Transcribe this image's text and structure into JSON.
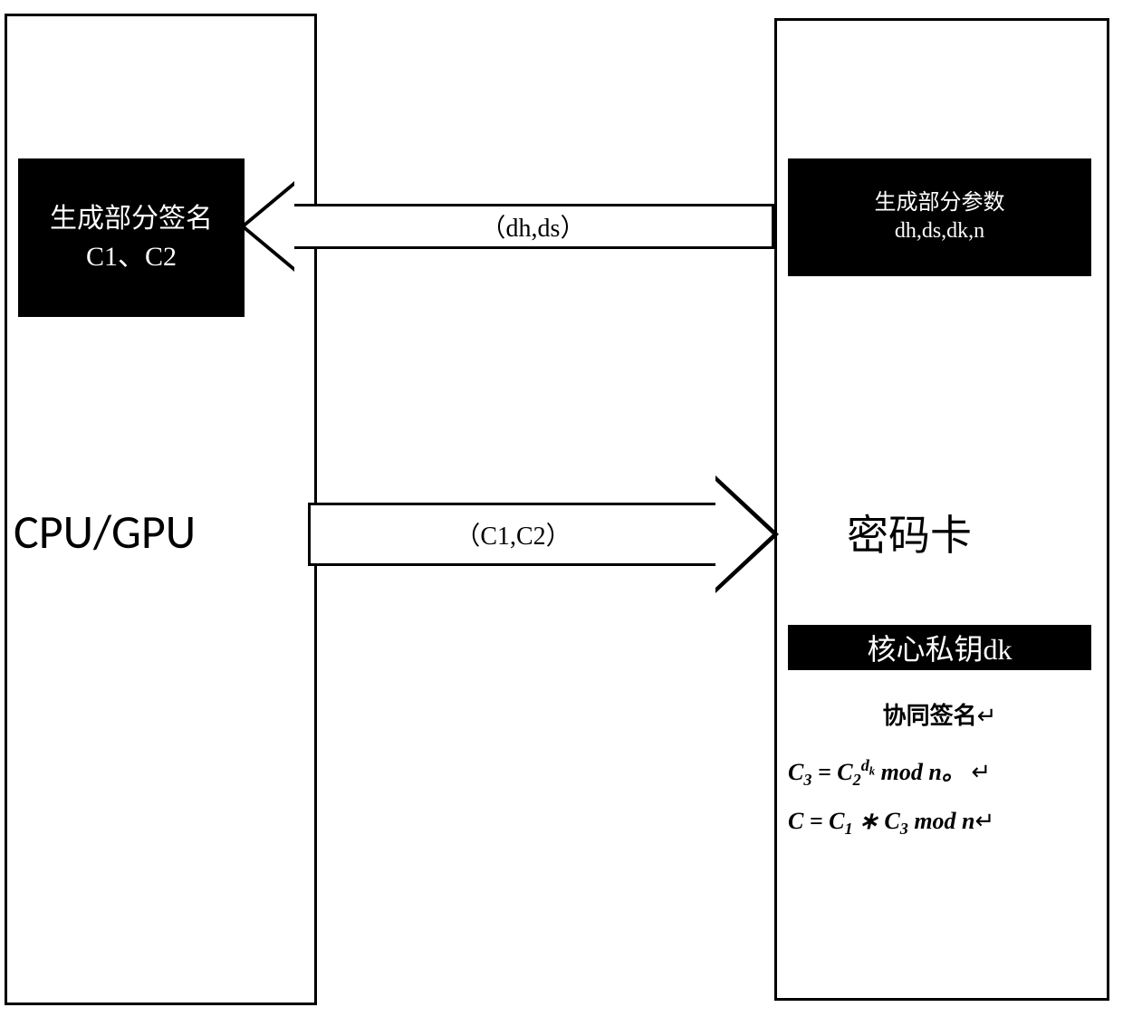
{
  "left_container": {
    "box_line1": "生成部分签名",
    "box_line2": "C1、C2",
    "label": "CPU/GPU"
  },
  "right_container": {
    "box_line1": "生成部分参数",
    "box_line2": "dh,ds,dk,n",
    "label": "密码卡",
    "core_key": "核心私钥dk",
    "formula_title": "协同签名",
    "formula1_prefix": "C",
    "formula1_sub1": "3",
    "formula1_eq": " = C",
    "formula1_sub2": "2",
    "formula1_sup": "d",
    "formula1_supsub": "k",
    "formula1_mod": " mod n",
    "formula1_end": "。",
    "formula2_prefix": "C = C",
    "formula2_sub1": "1",
    "formula2_mid": " ∗ C",
    "formula2_sub2": "3",
    "formula2_mod": "  mod n",
    "cursor": "↵"
  },
  "arrows": {
    "left_label": "（dh,ds）",
    "right_label": "（C1,C2）"
  }
}
